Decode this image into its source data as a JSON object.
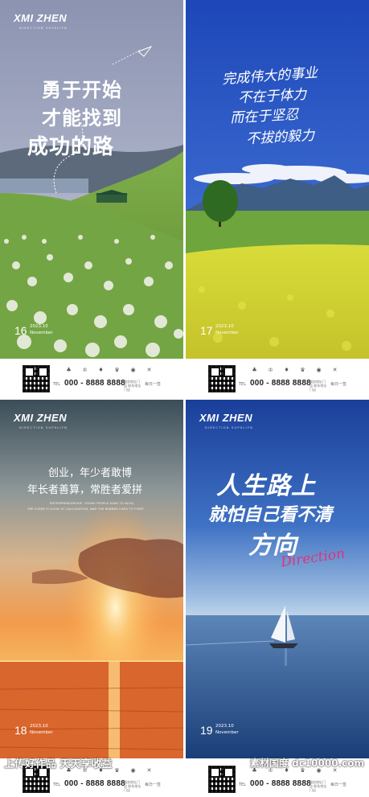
{
  "posters": [
    {
      "brand": "XMI ZHEN",
      "brand_sub": "DIRECTION SUPXLIFN",
      "lines": [
        "勇于开始",
        "才能找到",
        "成功的路"
      ],
      "day": "16",
      "year_month": "2023.10",
      "month": "November"
    },
    {
      "lines": [
        "完成伟大的事业",
        "不在于体力",
        "而在于坚忍",
        "不拔的毅力"
      ],
      "day": "17",
      "year_month": "2023.10",
      "month": "November"
    },
    {
      "brand": "XMI ZHEN",
      "brand_sub": "DIRECTION SUPXLIFN",
      "lines": [
        "创业，年少者敢博",
        "年长者善算，常胜者爱拼"
      ],
      "en_lines": [
        "ENTREPRENEURSHIP, YOUNG PEOPLE DARE TO BLOG,",
        "THE ELDER IS GOOD AT CALCULATION, AND THE WINNER LIKES TO FIGHT."
      ],
      "day": "18",
      "year_month": "2023.10",
      "month": "November"
    },
    {
      "brand": "XMI ZHEN",
      "brand_sub": "DIRECTION SUPXLIFN",
      "lines": [
        "人生路上",
        "就怕自己看不清",
        "方向"
      ],
      "script_word": "Direction",
      "day": "19",
      "year_month": "2023.10",
      "month": "November"
    }
  ],
  "footer": {
    "tel_label": "TEL",
    "phone": "000 - 8888 8888",
    "address": "服务地址门店 联系地址门店",
    "slogan": "每日一签"
  },
  "watermark": {
    "left": "上传好作品 天天享收益",
    "right": "素材国度 dc10000.com"
  },
  "colors": {
    "accent_pink": "#e0337a"
  }
}
